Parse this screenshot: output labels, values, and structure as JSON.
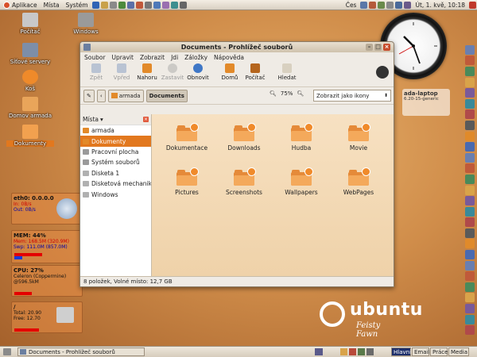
{
  "top_panel": {
    "menus": [
      "Aplikace",
      "Místa",
      "Systém"
    ],
    "right_text": "Čes",
    "clock": "Út, 1. kvě, 10:18"
  },
  "desktop_icons": [
    "Počítač",
    "Windows",
    "Síťové servery",
    "Koš",
    "Domov armada",
    "Dokumenty"
  ],
  "widgets": {
    "laptop_title": "ada-laptop",
    "laptop_sub": "6.20-15-generic"
  },
  "monitors": {
    "net": {
      "title": "eth0: 0.0.0.0",
      "in": "In:  0B/s",
      "out": "Out:  0B/s"
    },
    "mem": {
      "title": "MEM:  44%",
      "line1": "Mem: 168.5M (320.9M)",
      "line2": "Swp: 111.0M (857.0M)",
      "mem_fraction": 0.44,
      "swap_fraction": 0.13
    },
    "cpu": {
      "title": "CPU:  27%",
      "line1": "Celeron (Coppermine)",
      "line2": "@596.5kM",
      "cpu_fraction": 0.27
    },
    "disk": {
      "title": "/",
      "line1": "Total: 20.90",
      "line2": "Free:  12.70",
      "used_fraction": 0.39
    }
  },
  "window": {
    "title": "Documents - Prohlížeč souborů",
    "menus": [
      "Soubor",
      "Upravit",
      "Zobrazit",
      "Jdi",
      "Záložky",
      "Nápověda"
    ],
    "toolbar": [
      {
        "label": "Zpět",
        "icon": "back-arrow-icon",
        "disabled": true
      },
      {
        "label": "Vpřed",
        "icon": "forward-arrow-icon",
        "disabled": true
      },
      {
        "label": "Nahoru",
        "icon": "up-arrow-icon",
        "disabled": false
      },
      {
        "label": "Zastavit",
        "icon": "stop-icon",
        "disabled": true
      },
      {
        "label": "Obnovit",
        "icon": "reload-icon",
        "disabled": false
      },
      {
        "label": "Domů",
        "icon": "home-icon",
        "disabled": false
      },
      {
        "label": "Počítač",
        "icon": "computer-icon",
        "disabled": false
      },
      {
        "label": "Hledat",
        "icon": "search-icon",
        "disabled": false
      }
    ],
    "location": {
      "path": [
        "armada",
        "Documents"
      ],
      "zoom": "75%",
      "view": "Zobrazit jako ikony"
    },
    "sidebar": {
      "header": "Místa",
      "items": [
        "armada",
        "Dokumenty",
        "Pracovní plocha",
        "Systém souborů",
        "Disketa 1",
        "Disketová mechanika",
        "Windows"
      ],
      "selected": 1
    },
    "files": [
      "Dokumentace",
      "Downloads",
      "Hudba",
      "Movie",
      "Pictures",
      "Screenshots",
      "Wallpapers",
      "WebPages"
    ],
    "status": "8 položek, Volné místo: 12,7 GB"
  },
  "branding": {
    "word": "ubuntu",
    "edition": "Feisty Fawn"
  },
  "bottom_panel": {
    "task": "Documents - Prohlížeč souborů",
    "workspaces": [
      "Hlavní",
      "Email",
      "Práce",
      "Media"
    ],
    "active_workspace": 0
  },
  "colors": {
    "accent": "#e2781e",
    "folder": "#f4a95b",
    "panel": "#e8e1d4"
  }
}
